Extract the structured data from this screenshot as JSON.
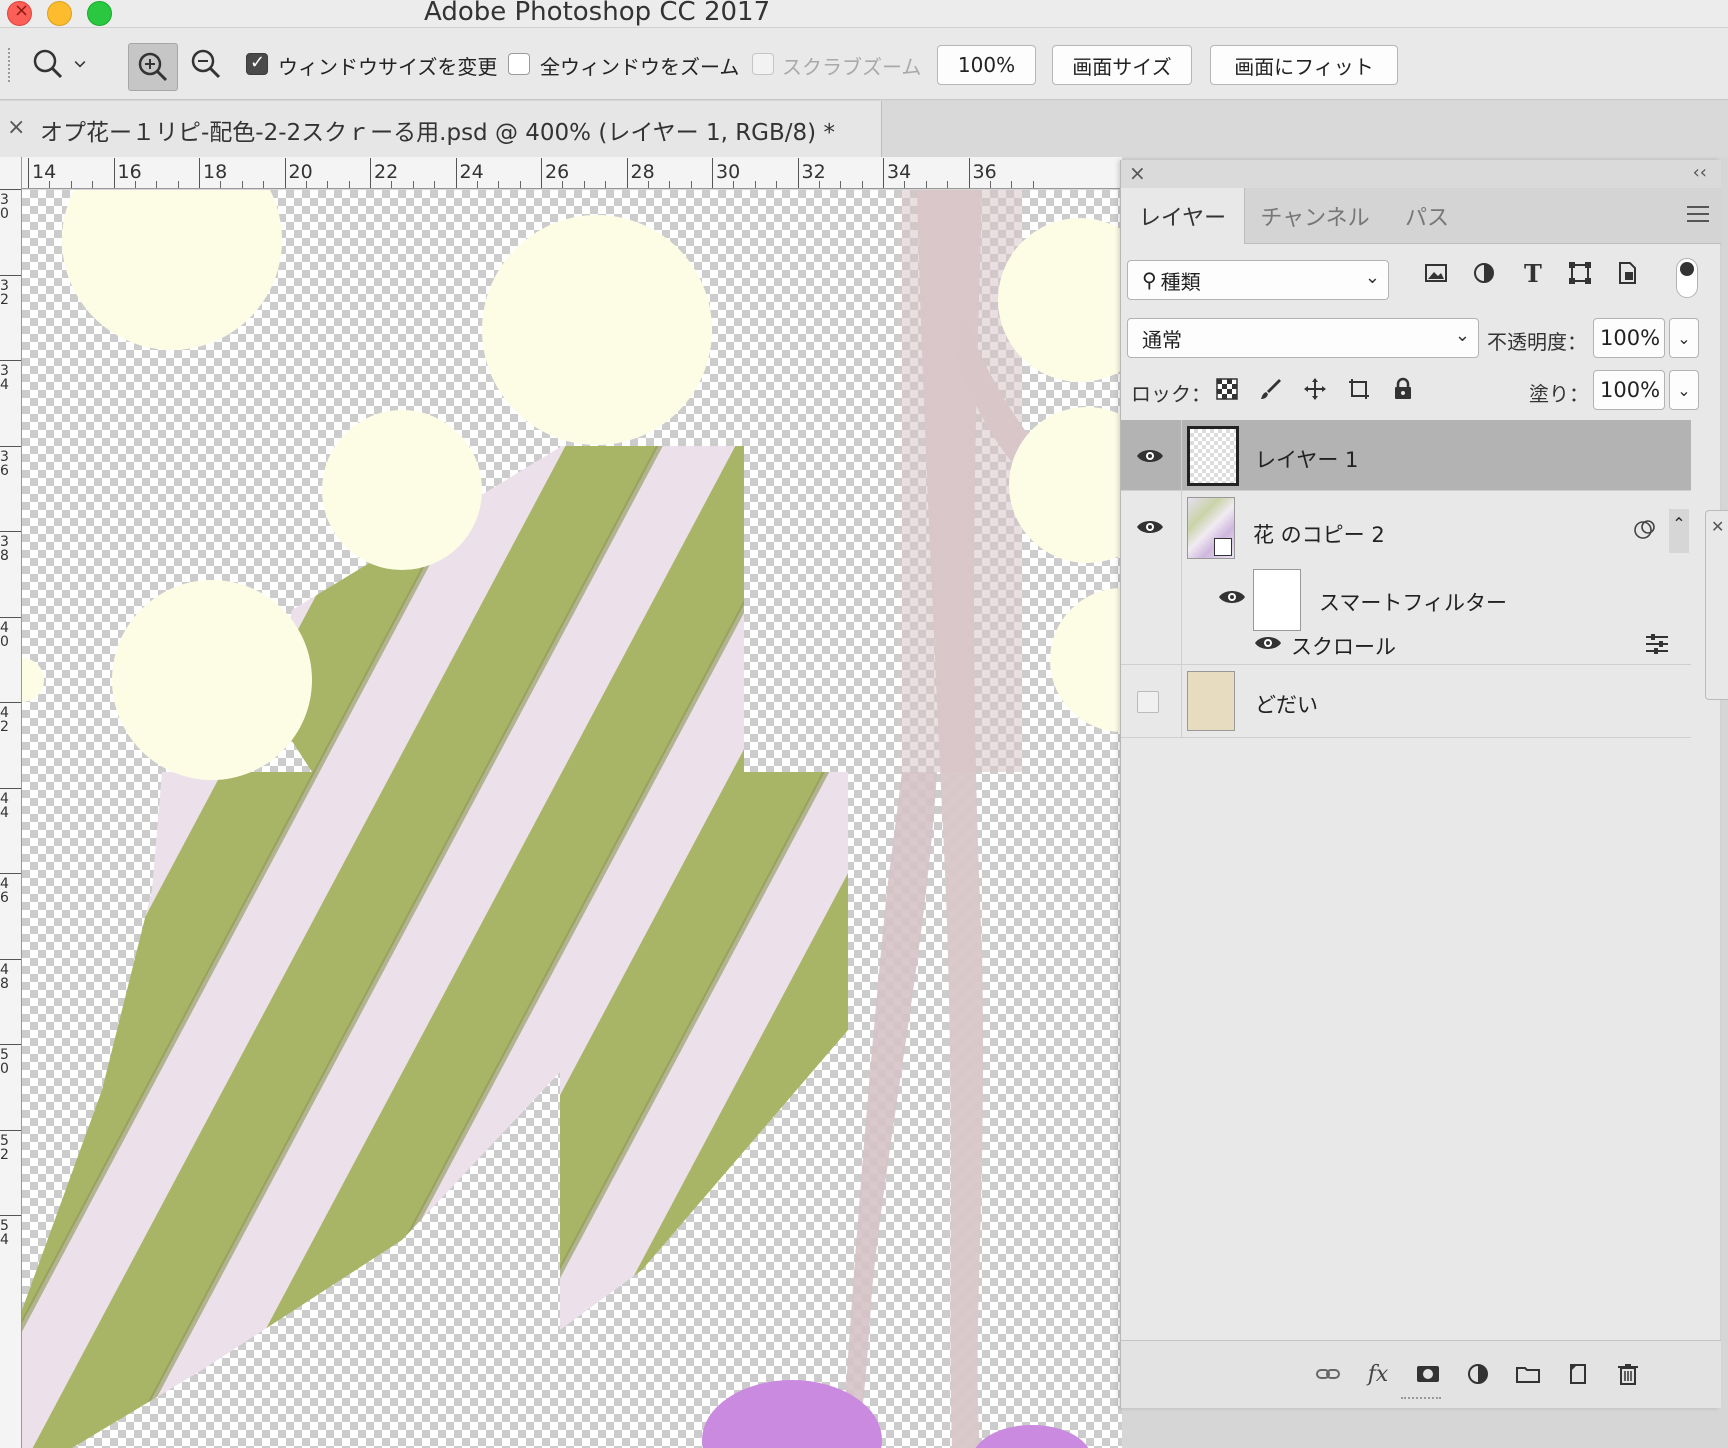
{
  "window": {
    "title": "Adobe Photoshop CC 2017"
  },
  "options_bar": {
    "resize_windows_label": "ウィンドウサイズを変更",
    "resize_windows_checked": true,
    "zoom_all_label": "全ウィンドウをズーム",
    "zoom_all_checked": false,
    "scrubby_zoom_label": "スクラブズーム",
    "scrubby_zoom_enabled": false,
    "zoom_value": "100%",
    "fit_screen_size_label": "画面サイズ",
    "fit_screen_label": "画面にフィット"
  },
  "document": {
    "close": "×",
    "tab_title": "オプ花ー１リピ-配色-2-2スクｒーる用.psd @ 400% (レイヤー 1, RGB/8) *"
  },
  "ruler": {
    "h_labels": [
      "14",
      "16",
      "18",
      "20",
      "22",
      "24",
      "26",
      "28",
      "30",
      "32",
      "34",
      "36"
    ],
    "v_labels": [
      "3\n0",
      "3\n2",
      "3\n4",
      "3\n6",
      "3\n8",
      "4\n0",
      "4\n2",
      "4\n4",
      "4\n6",
      "4\n8",
      "5\n0",
      "5\n2",
      "5\n4"
    ]
  },
  "layers_panel": {
    "close": "×",
    "collapse": "‹‹",
    "tabs": [
      "レイヤー",
      "チャンネル",
      "パス"
    ],
    "active_tab": "レイヤー",
    "filter_kind": "種類",
    "blend_mode": "通常",
    "opacity_label": "不透明度：",
    "opacity_value": "100%",
    "lock_label": "ロック：",
    "fill_label": "塗り：",
    "fill_value": "100%",
    "layers": [
      {
        "name": "レイヤー 1",
        "visible": true,
        "selected": true,
        "thumb": "transparent"
      },
      {
        "name": "花 のコピー 2",
        "visible": true,
        "selected": false,
        "thumb": "smart-object"
      },
      {
        "name": "スマートフィルター",
        "visible": true,
        "selected": false,
        "thumb": "white-mask"
      },
      {
        "name": "スクロール",
        "visible": true,
        "selected": false,
        "thumb": "none"
      },
      {
        "name": "どだい",
        "visible": false,
        "selected": false,
        "thumb": "beige"
      }
    ]
  },
  "colors": {
    "background_layer": "#e8dcc0",
    "stripe_green": "#a9b566",
    "stripe_pink": "#ece1ea",
    "dot_cream": "#fdfde6",
    "stem": "#d9c7c9",
    "flower_violet": "#c98ae0"
  }
}
